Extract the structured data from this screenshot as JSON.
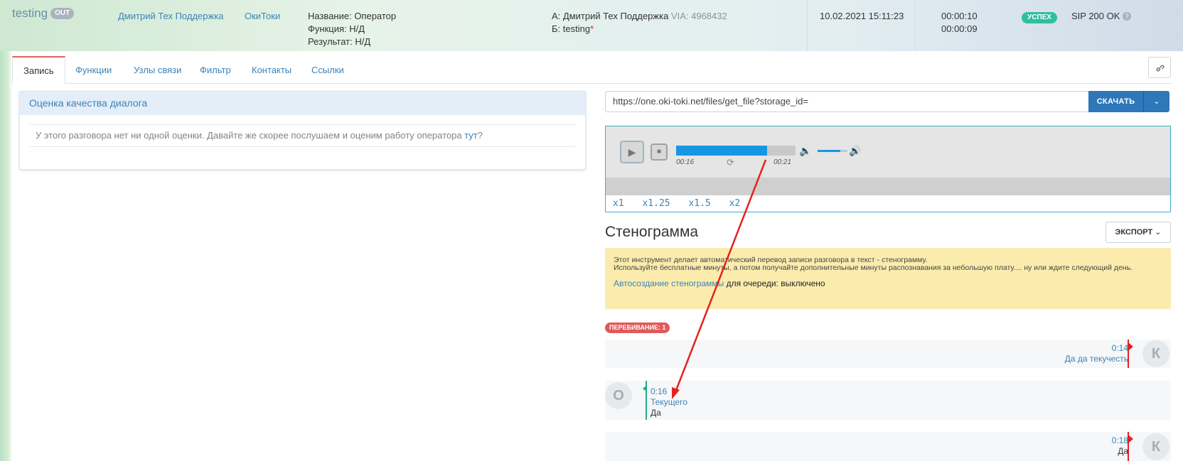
{
  "header": {
    "title": "testing",
    "direction_badge": "OUT",
    "operator": "Дмитрий Тех Поддержка",
    "company": "ОкиТоки",
    "info_lines": [
      "Название: Оператор",
      "Функция: Н/Д",
      "Результат: Н/Д"
    ],
    "party_a_prefix": "А: Дмитрий Тех Поддержка",
    "party_a_via": "VIA: 4968432",
    "party_b": "Б: testing",
    "party_b_mark": "*",
    "datetime": "10.02.2021 15:11:23",
    "duration_1": "00:00:10",
    "duration_2": "00:00:09",
    "status_badge": "УСПЕХ",
    "sip_status": "SIP 200 OK",
    "help_icon": "?"
  },
  "tabs": [
    "Запись",
    "Функции",
    "Узлы связи",
    "Фильтр",
    "Контакты",
    "Ссылки"
  ],
  "evaluation": {
    "title": "Оценка качества диалога",
    "empty_text": "У этого разговора нет ни одной оценки. Давайте же скорее послушаем и оценим работу оператора ",
    "link_text": "тут",
    "suffix": "?"
  },
  "download": {
    "url": "https://one.oki-toki.net/files/get_file?storage_id=",
    "button_label": "СКАЧАТЬ"
  },
  "player": {
    "current_time": "00:16",
    "total_time": "00:21",
    "progress": 0.76,
    "volume": 0.75,
    "speeds": [
      "x1",
      "x1.25",
      "x1.5",
      "x2"
    ]
  },
  "transcript": {
    "title": "Стенограмма",
    "export_label": "ЭКСПОРТ",
    "notice_line1": "Этот инструмент делает автоматический перевод записи разговора в текст - стенограмму.",
    "notice_line2": "Используйте бесплатные минуты, а потом получайте дополнительные минуты распознавания за небольшую плату.... ну или ждите следующий день.",
    "notice_link": "Автосоздание стенограммы",
    "notice_rest": " для очереди: выключено",
    "interrupt_badge": "ПЕРЕБИВАНИЕ: 1",
    "messages": [
      {
        "side": "right",
        "avatar": "К",
        "time": "0:14",
        "text_primary": "Да да текучесть",
        "text_secondary": ""
      },
      {
        "side": "left",
        "avatar": "О",
        "time": "0:16",
        "text_primary": "Текущего",
        "text_secondary": "Да"
      },
      {
        "side": "right",
        "avatar": "К",
        "time": "0:18",
        "text_primary": "",
        "text_secondary": "Да"
      }
    ]
  },
  "colors": {
    "accent": "#3b83b8",
    "primary_button": "#2e77b8",
    "progress": "#1797e3",
    "success": "#2fbfa0",
    "interrupt": "#e05a5a",
    "annotation_arrow": "#e8201f"
  }
}
